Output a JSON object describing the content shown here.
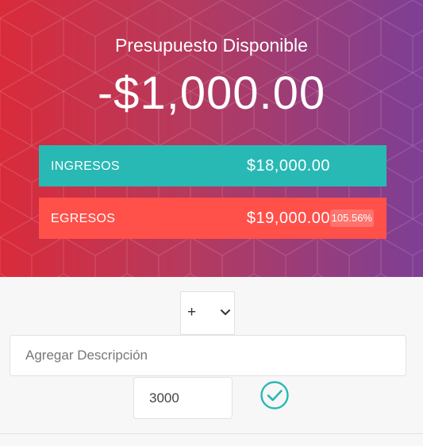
{
  "header": {
    "title": "Presupuesto Disponible",
    "available_budget": "-$1,000.00"
  },
  "summary": {
    "income": {
      "label": "INGRESOS",
      "value": "$18,000.00"
    },
    "expense": {
      "label": "EGRESOS",
      "value": "$19,000.00",
      "percentage": "105.56%"
    }
  },
  "form": {
    "type_select": {
      "selected": "+",
      "options": [
        "+"
      ]
    },
    "description": {
      "value": "",
      "placeholder": "Agregar Descripción"
    },
    "amount": {
      "value": "3000"
    },
    "add_icon": "check-circle-icon"
  },
  "colors": {
    "income": "#28b9b5",
    "expense": "#ff5049",
    "accent": "#28b9b5"
  }
}
